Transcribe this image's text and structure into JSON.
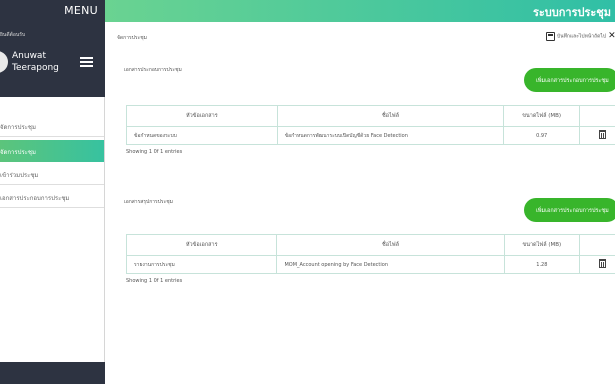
{
  "sidebar": {
    "menu_label": "MENU",
    "welcome": "ยินดีต้อนรับ",
    "user_first": "Anuwat",
    "user_last": "Teerapong",
    "items": [
      {
        "label": "จัดการประชุม",
        "active": false
      },
      {
        "label": "จัดการประชุม",
        "active": true
      },
      {
        "label": "เข้าร่วมประชุม",
        "active": false
      },
      {
        "label": "เอกสารประกอบการประชุม",
        "active": false
      }
    ]
  },
  "header": {
    "title": "ระบบการประชุม"
  },
  "breadcrumb": "จัดการประชุม",
  "toolbar": {
    "save_label": "บันทึกและไปหน้าถัดไป"
  },
  "sections": [
    {
      "title": "เอกสารประกอบการประชุม",
      "add_label": "เพิ่มเอกสารประกอบการประชุม",
      "columns": [
        "หัวข้อเอกสาร",
        "ชื่อไฟล์",
        "ขนาดไฟล์ (MB)",
        ""
      ],
      "rows": [
        {
          "topic": "ข้อกำหนดของระบบ",
          "file": "ข้อกำหนดการพัฒนาระบบเปิดบัญชีด้วย Face Detection",
          "size": "0.97"
        }
      ],
      "entries": "Showing 1 0f 1 entries"
    },
    {
      "title": "เอกสารสรุปการประชุม",
      "add_label": "เพิ่มเอกสารประกอบการประชุม",
      "columns": [
        "หัวข้อเอกสาร",
        "ชื่อไฟล์",
        "ขนาดไฟล์ (MB)",
        ""
      ],
      "rows": [
        {
          "topic": "รายงานการประชุม",
          "file": "MOM_Account opening by Face Detection",
          "size": "1.28"
        }
      ],
      "entries": "Showing 1 0f 1 entries"
    }
  ],
  "icons": {
    "save": "save-icon",
    "close": "close-icon",
    "delete": "trash-icon",
    "menu": "hamburger-icon"
  },
  "colors": {
    "sidebar_dark": "#2d3341",
    "header_gradient_start": "#6ad391",
    "header_gradient_end": "#30bfa6",
    "button_green": "#38b52b"
  }
}
